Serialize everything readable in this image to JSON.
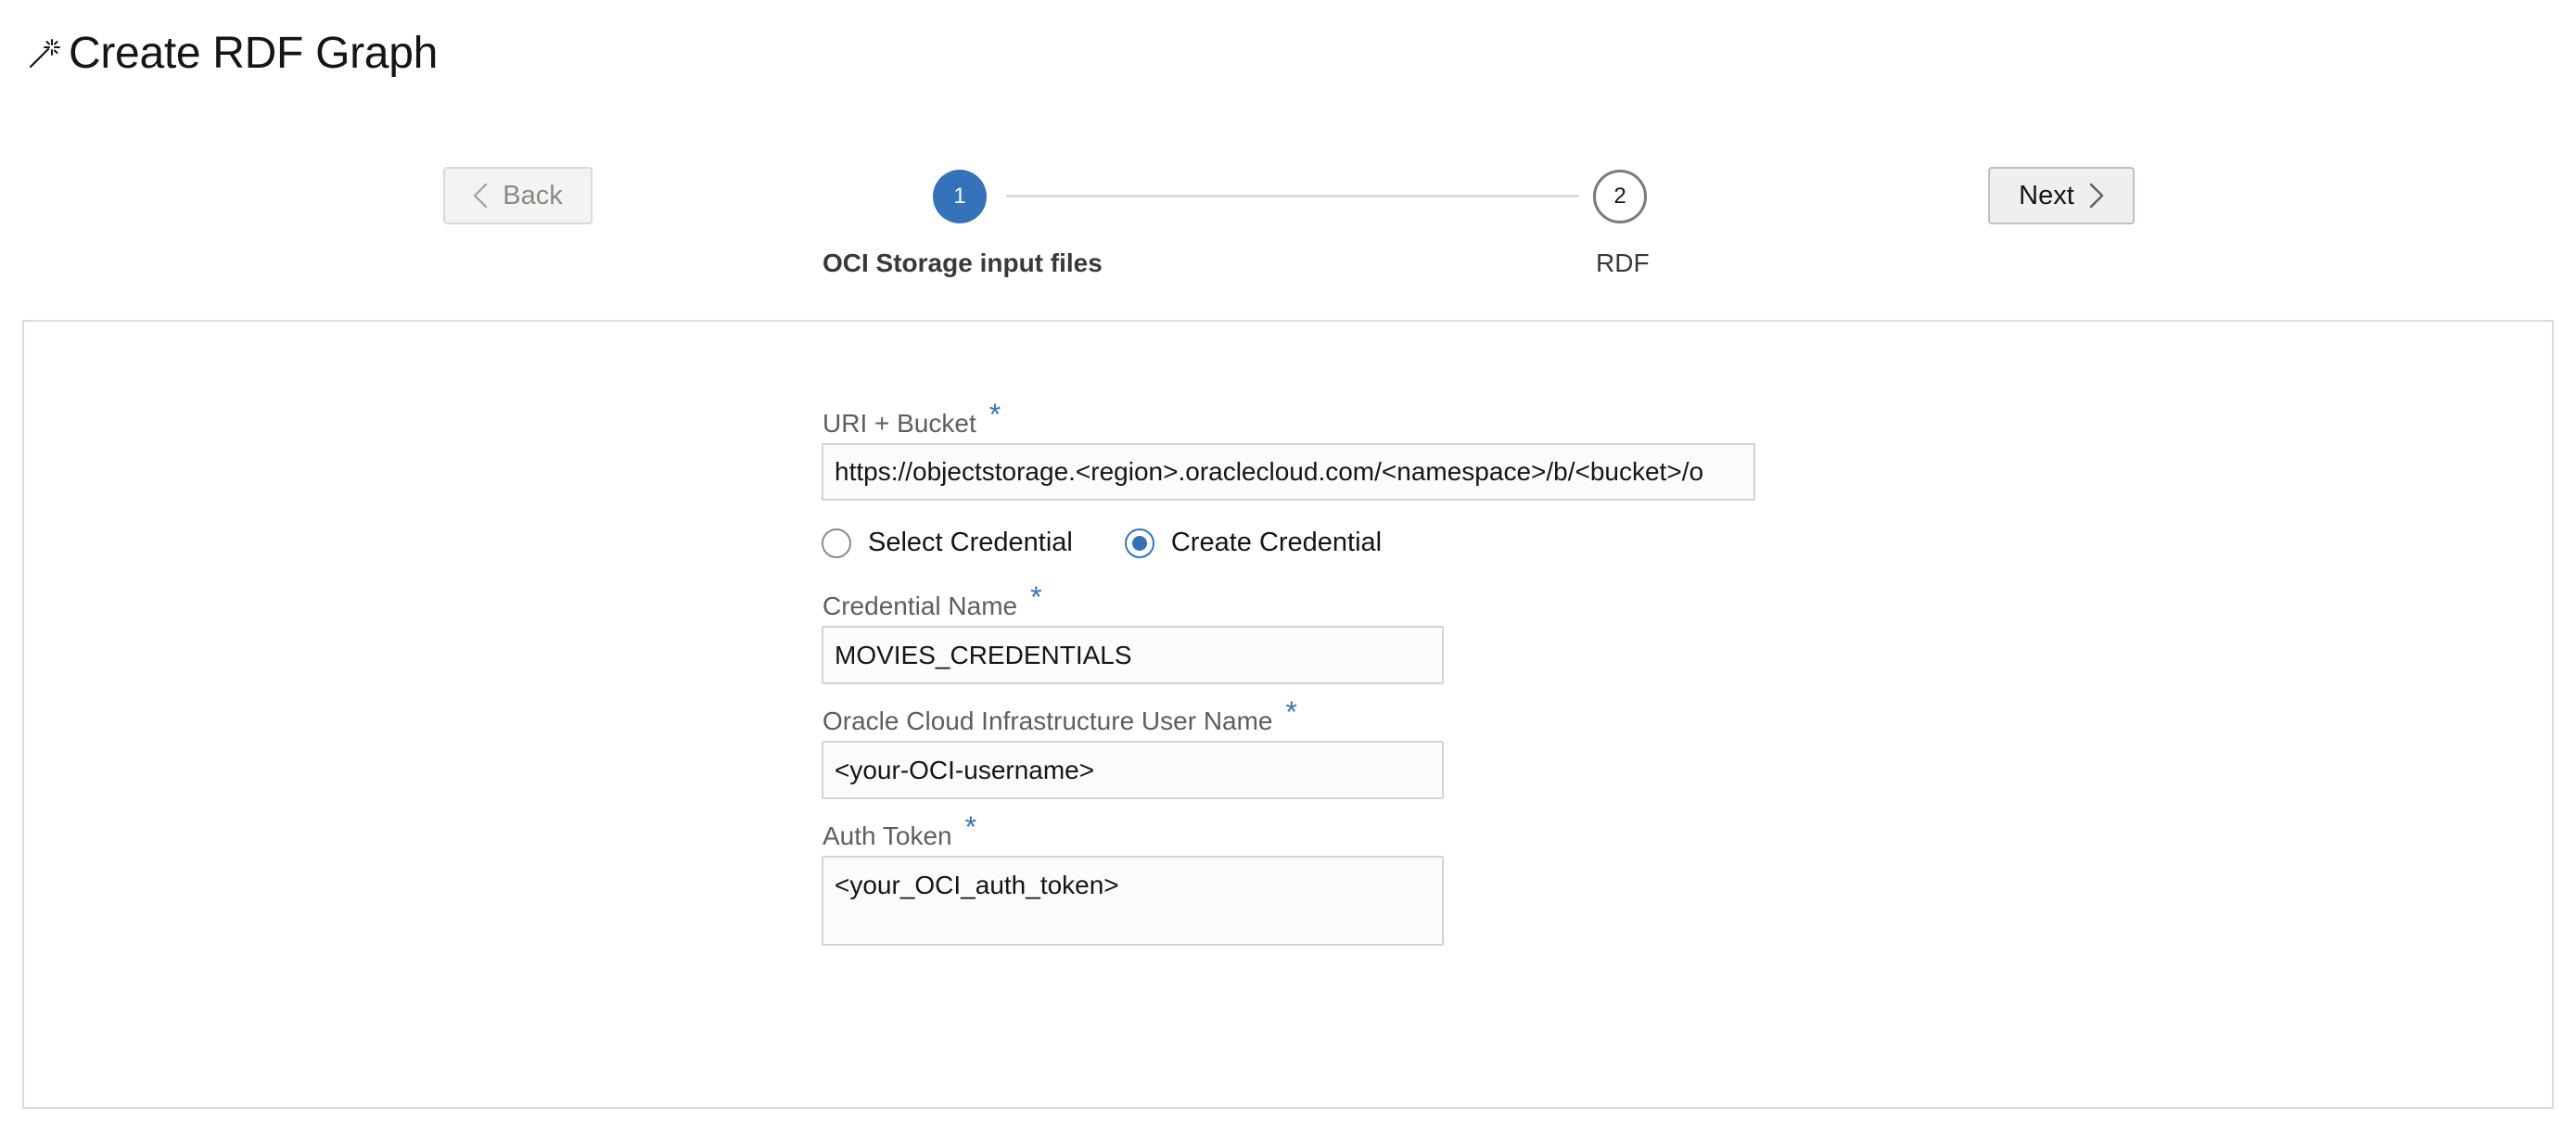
{
  "header": {
    "title": "Create RDF Graph",
    "icon": "magic-wand-icon"
  },
  "nav": {
    "back_label": "Back",
    "next_label": "Next"
  },
  "train": {
    "steps": [
      {
        "number": "1",
        "label": "OCI Storage input files",
        "state": "current"
      },
      {
        "number": "2",
        "label": "RDF",
        "state": "upcoming"
      }
    ],
    "accent_color": "#3473b9"
  },
  "form": {
    "required_marker": "*",
    "uri_bucket": {
      "label": "URI + Bucket",
      "value": "https://objectstorage.<region>.oraclecloud.com/<namespace>/b/<bucket>/o"
    },
    "credential_mode": {
      "options": [
        "Select Credential",
        "Create Credential"
      ],
      "selected": "Create Credential"
    },
    "credential_name": {
      "label": "Credential Name",
      "value": "MOVIES_CREDENTIALS"
    },
    "oci_user_name": {
      "label": "Oracle Cloud Infrastructure User Name",
      "value": "<your-OCI-username>"
    },
    "auth_token": {
      "label": "Auth Token",
      "value": "<your_OCI_auth_token>"
    }
  }
}
